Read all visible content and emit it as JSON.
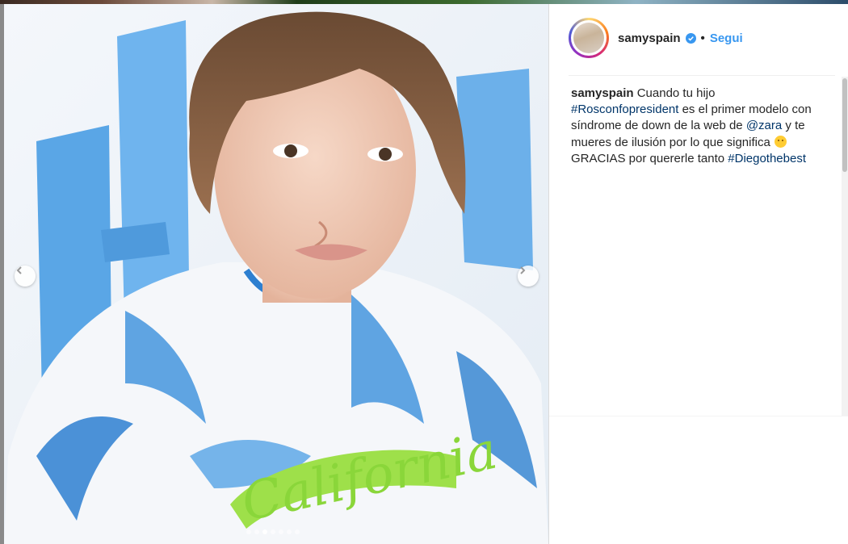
{
  "photo": {
    "shirt_text": "California",
    "carousel_dots": 7,
    "active_dot_index": 2
  },
  "header": {
    "username": "samyspain",
    "separator": "•",
    "follow_label": "Segui"
  },
  "caption": {
    "username": "samyspain",
    "text1": " Cuando tu hijo ",
    "tag1": "#Rosconfopresident",
    "text2": " es el primer modelo con síndrome de down de la web de ",
    "mention1": "@zara",
    "text3": " y te mueres de ilusión por lo que significa ",
    "emoji": "smiling-face",
    "text4": "GRACIAS por quererle tanto ",
    "tag2": "#Diegothebest"
  },
  "colors": {
    "link_blue": "#3897f0",
    "hashtag": "#003569",
    "verified": "#3897f0"
  }
}
